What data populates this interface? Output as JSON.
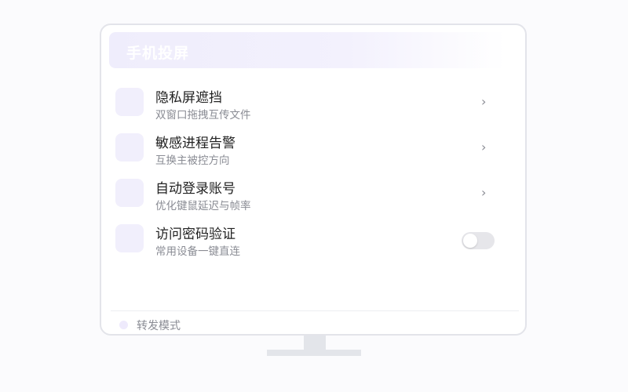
{
  "header": {
    "title": "手机投屏"
  },
  "items": [
    {
      "title": "隐私屏遮挡",
      "subtitle": "双窗口拖拽互传文件",
      "chevron": "›"
    },
    {
      "title": "敏感进程告警",
      "subtitle": "互换主被控方向",
      "chevron": "›"
    },
    {
      "title": "自动登录账号",
      "subtitle": "优化键鼠延迟与帧率",
      "chevron": "›"
    },
    {
      "title": "访问密码验证",
      "subtitle": "常用设备一键直连",
      "toggle_on": false
    }
  ],
  "footer": {
    "label": "转发模式"
  },
  "colors": {
    "accent_light": "#f1effc",
    "text_primary": "#222222",
    "text_secondary": "#8a8c94"
  }
}
